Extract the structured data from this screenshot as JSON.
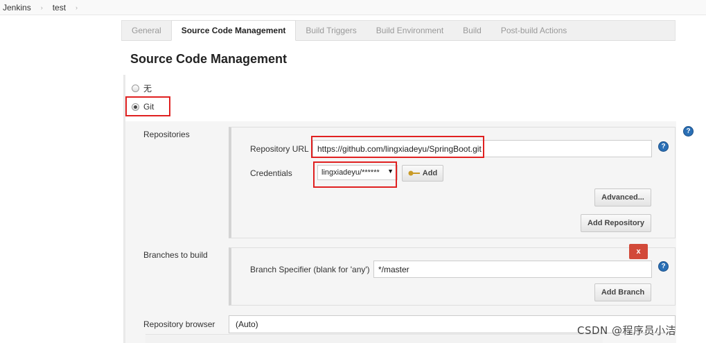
{
  "breadcrumb": {
    "items": [
      "Jenkins",
      "test"
    ],
    "separator": "›"
  },
  "tabs": [
    {
      "label": "General",
      "active": false
    },
    {
      "label": "Source Code Management",
      "active": true
    },
    {
      "label": "Build Triggers",
      "active": false
    },
    {
      "label": "Build Environment",
      "active": false
    },
    {
      "label": "Build",
      "active": false
    },
    {
      "label": "Post-build Actions",
      "active": false
    }
  ],
  "section_title": "Source Code Management",
  "scm_options": [
    {
      "label": "无",
      "checked": false
    },
    {
      "label": "Git",
      "checked": true
    }
  ],
  "repositories": {
    "label": "Repositories",
    "url_label": "Repository URL",
    "url_value": "https://github.com/lingxiadeyu/SpringBoot.git",
    "credentials_label": "Credentials",
    "credentials_value": "lingxiadeyu/******",
    "add_label": "Add",
    "advanced_label": "Advanced...",
    "add_repository_label": "Add Repository"
  },
  "branches": {
    "label": "Branches to build",
    "delete_label": "x",
    "specifier_label": "Branch Specifier (blank for 'any')",
    "specifier_value": "*/master",
    "add_branch_label": "Add Branch"
  },
  "browser": {
    "label": "Repository browser",
    "value": "(Auto)"
  },
  "help_glyph": "?",
  "watermark": "CSDN @程序员小洁",
  "colors": {
    "help_blue": "#2a6fb5",
    "delete_red": "#d24939",
    "highlight_red": "#e02020"
  }
}
